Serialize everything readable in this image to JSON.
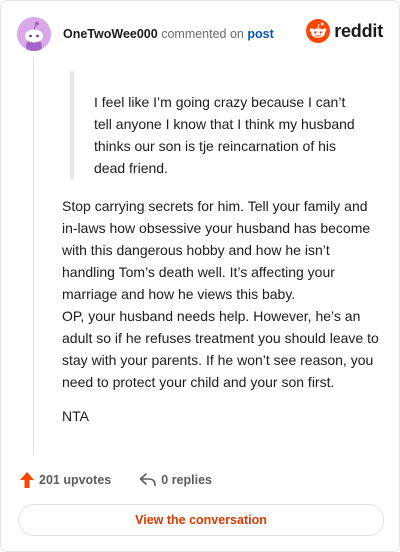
{
  "header": {
    "username": "OneTwoWee000",
    "commented_text": "commented on",
    "post_link": "post",
    "brand": "reddit"
  },
  "quote": {
    "text": "I feel like I’m going crazy because I can’t tell anyone I know that I think my husband thinks our son is tje reincarnation of his dead friend."
  },
  "comment": {
    "paragraphs": [
      "Stop carrying secrets for him. Tell your family and in-laws how obsessive your husband has become with this dangerous hobby and how he isn’t handling Tom’s death well. It’s affecting your marriage and how he views this baby.",
      "OP, your husband needs help. However, he’s an adult so if he refuses treatment you should leave to stay with your parents. If he won’t see reason, you need to protect your child and your son first.",
      "NTA"
    ]
  },
  "actions": {
    "upvotes": "201 upvotes",
    "replies": "0 replies"
  },
  "view_button": "View the conversation",
  "colors": {
    "brand_orange": "#ff4500",
    "link_blue": "#0a53be",
    "button_text": "#d93a00",
    "avatar_bg": "#d8a8e8"
  },
  "icons": {
    "avatar": "snoo-avatar-icon",
    "logo": "reddit-logo-icon",
    "upvote": "upvote-arrow-icon",
    "reply": "reply-arrow-icon"
  }
}
